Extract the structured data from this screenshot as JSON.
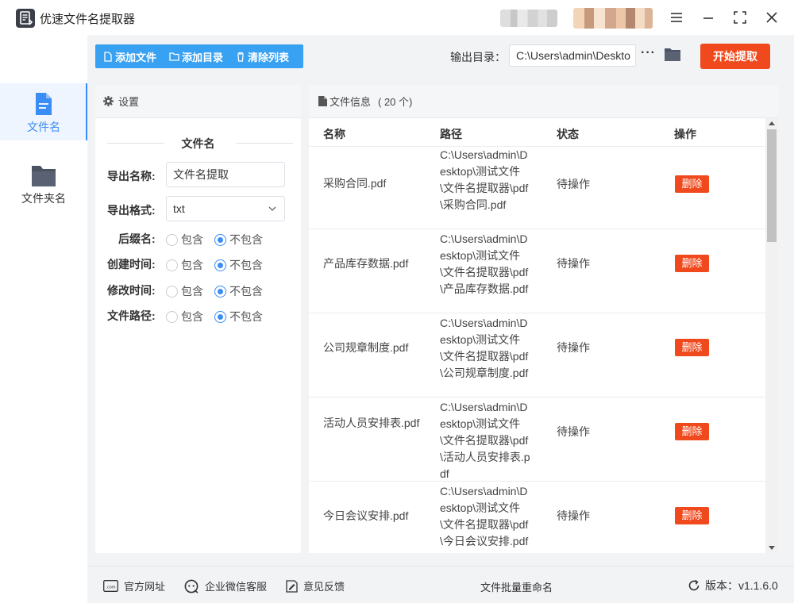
{
  "app": {
    "title": "优速文件名提取器"
  },
  "window_controls": [
    "menu-icon",
    "minimize-icon",
    "maximize-icon",
    "close-icon"
  ],
  "sidebar": {
    "items": [
      {
        "label": "文件名",
        "icon": "file-icon",
        "active": true
      },
      {
        "label": "文件夹名",
        "icon": "folder-icon",
        "active": false
      }
    ]
  },
  "toolbar": {
    "add_file": "添加文件",
    "add_dir": "添加目录",
    "clear_list": "清除列表",
    "output_label": "输出目录：",
    "output_value": "C:\\Users\\admin\\Deskto",
    "more": "···",
    "start": "开始提取"
  },
  "settings": {
    "header": "设置",
    "section_title": "文件名",
    "export_name_label": "导出名称:",
    "export_name_value": "文件名提取",
    "export_format_label": "导出格式:",
    "export_format_value": "txt",
    "options": [
      {
        "label": "后缀名:",
        "include": "包含",
        "exclude": "不包含",
        "selected": "exclude"
      },
      {
        "label": "创建时间:",
        "include": "包含",
        "exclude": "不包含",
        "selected": "exclude"
      },
      {
        "label": "修改时间:",
        "include": "包含",
        "exclude": "不包含",
        "selected": "exclude"
      },
      {
        "label": "文件路径:",
        "include": "包含",
        "exclude": "不包含",
        "selected": "exclude"
      }
    ]
  },
  "files": {
    "header": "文件信息",
    "count": "( 20 个)",
    "columns": [
      "名称",
      "路径",
      "状态",
      "操作"
    ],
    "rows": [
      {
        "name": "采购合同.pdf",
        "path": "C:\\Users\\admin\\Desktop\\测试文件\\文件名提取器\\pdf\\采购合同.pdf",
        "status": "待操作",
        "action": "删除"
      },
      {
        "name": "产品库存数据.pdf",
        "path": "C:\\Users\\admin\\Desktop\\测试文件\\文件名提取器\\pdf\\产品库存数据.pdf",
        "status": "待操作",
        "action": "删除"
      },
      {
        "name": "公司规章制度.pdf",
        "path": "C:\\Users\\admin\\Desktop\\测试文件\\文件名提取器\\pdf\\公司规章制度.pdf",
        "status": "待操作",
        "action": "删除"
      },
      {
        "name": "活动人员安排表.pdf",
        "path": "C:\\Users\\admin\\Desktop\\测试文件\\文件名提取器\\pdf\\活动人员安排表.pdf",
        "status": "待操作",
        "action": "删除"
      },
      {
        "name": "今日会议安排.pdf",
        "path": "C:\\Users\\admin\\Desktop\\测试文件\\文件名提取器\\pdf\\今日会议安排.pdf",
        "status": "待操作",
        "action": "删除"
      }
    ]
  },
  "footer": {
    "website": "官方网址",
    "wechat": "企业微信客服",
    "feedback": "意见反馈",
    "center": "文件批量重命名",
    "version": "版本：v1.1.6.0"
  },
  "colors": {
    "accent": "#3b8cf5",
    "toolbar": "#39a1f2",
    "danger": "#f0491d",
    "panel_bg": "#f2f3f5"
  }
}
